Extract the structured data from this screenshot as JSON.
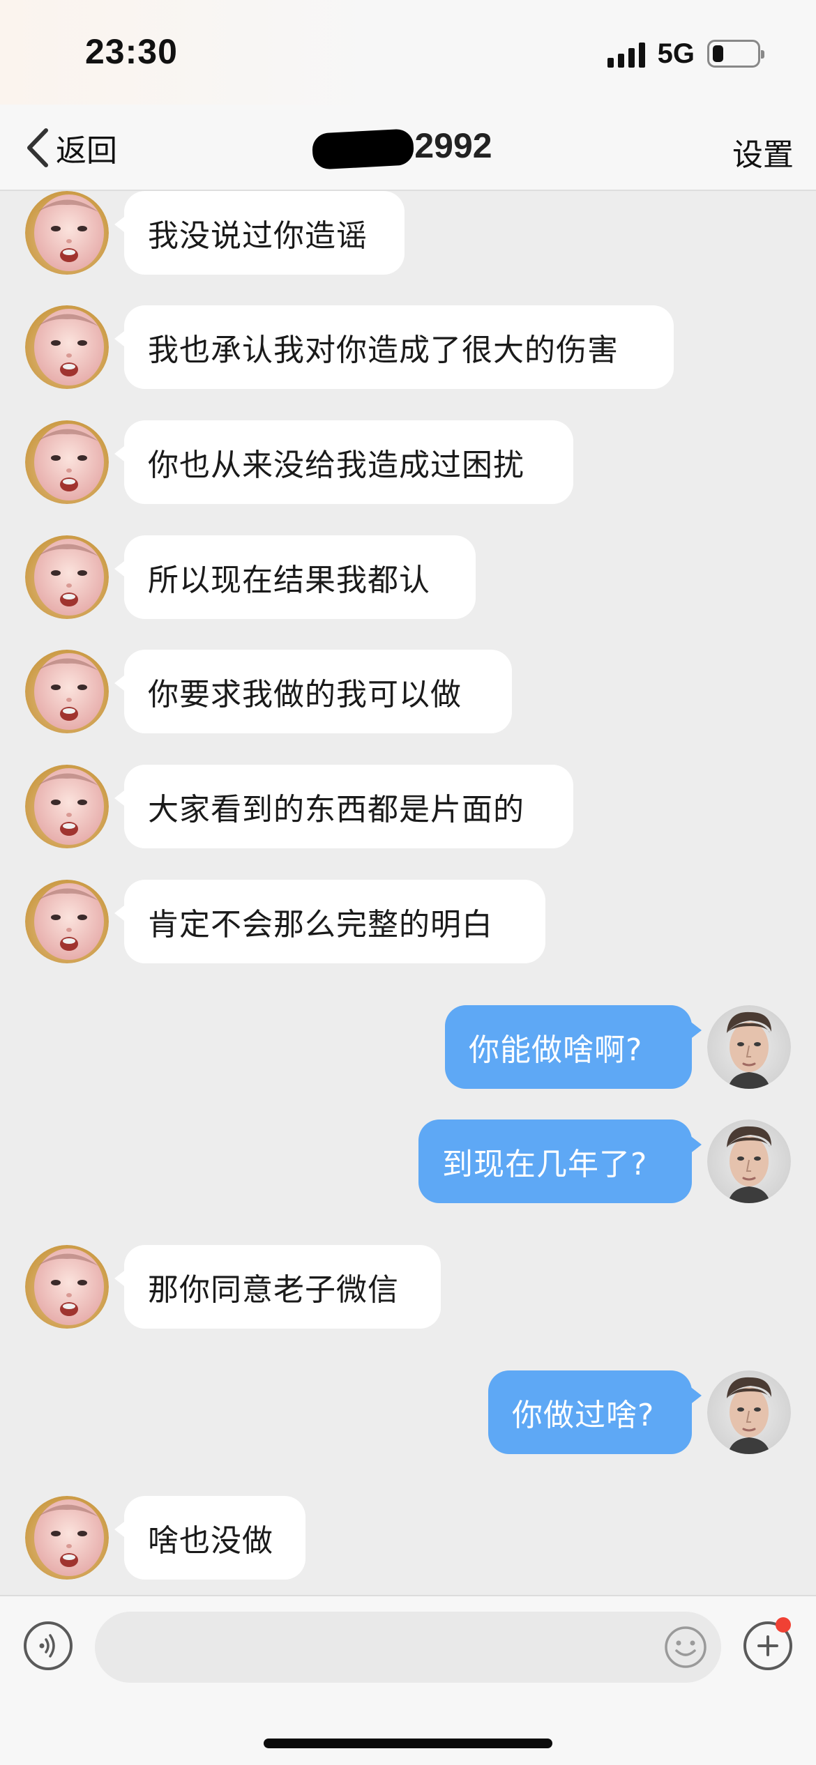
{
  "status_bar": {
    "time": "23:30",
    "network": "5G",
    "battery_level": 0.25
  },
  "nav": {
    "back_label": "返回",
    "title_visible": "2992",
    "settings_label": "设置"
  },
  "messages": [
    {
      "side": "left",
      "text": "我没说过你造谣"
    },
    {
      "side": "left",
      "text": "我也承认我对你造成了很大的伤害"
    },
    {
      "side": "left",
      "text": "你也从来没给我造成过困扰"
    },
    {
      "side": "left",
      "text": "所以现在结果我都认"
    },
    {
      "side": "left",
      "text": "你要求我做的我可以做"
    },
    {
      "side": "left",
      "text": "大家看到的东西都是片面的"
    },
    {
      "side": "left",
      "text": "肯定不会那么完整的明白"
    },
    {
      "side": "right",
      "text": "你能做啥啊?"
    },
    {
      "side": "right",
      "text": "到现在几年了?"
    },
    {
      "side": "left",
      "text": "那你同意老子微信"
    },
    {
      "side": "right",
      "text": "你做过啥?"
    },
    {
      "side": "left",
      "text": "啥也没做"
    }
  ],
  "input": {
    "value": "",
    "placeholder": ""
  },
  "colors": {
    "my_bubble": "#5ea8f5",
    "their_bubble": "#ffffff",
    "chat_background": "#ededed",
    "notification_dot": "#f04134"
  },
  "icons": {
    "back": "chevron-left-icon",
    "voice": "voice-icon",
    "emoji": "emoji-icon",
    "plus": "plus-icon"
  }
}
